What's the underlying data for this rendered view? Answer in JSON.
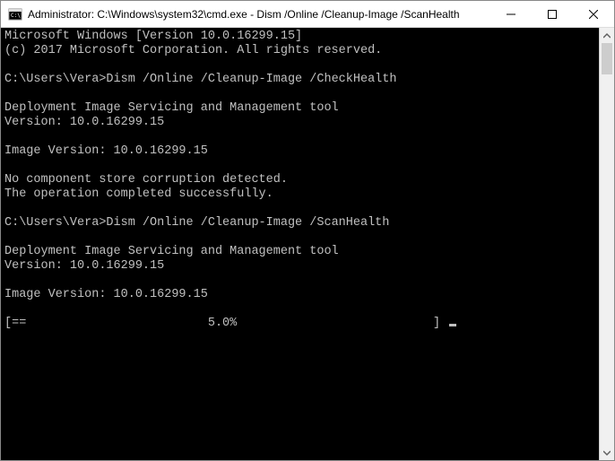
{
  "titlebar": {
    "title": "Administrator: C:\\Windows\\system32\\cmd.exe - Dism  /Online /Cleanup-Image /ScanHealth"
  },
  "console": {
    "header_line1": "Microsoft Windows [Version 10.0.16299.15]",
    "header_line2": "(c) 2017 Microsoft Corporation. All rights reserved.",
    "prompt1_path": "C:\\Users\\Vera>",
    "prompt1_cmd": "Dism /Online /Cleanup-Image /CheckHealth",
    "tool_name": "Deployment Image Servicing and Management tool",
    "tool_version": "Version: 10.0.16299.15",
    "image_version": "Image Version: 10.0.16299.15",
    "result_line1": "No component store corruption detected.",
    "result_line2": "The operation completed successfully.",
    "prompt2_path": "C:\\Users\\Vera>",
    "prompt2_cmd": "Dism /Online /Cleanup-Image /ScanHealth",
    "progress_line": "[==                         5.0%                           ] "
  }
}
